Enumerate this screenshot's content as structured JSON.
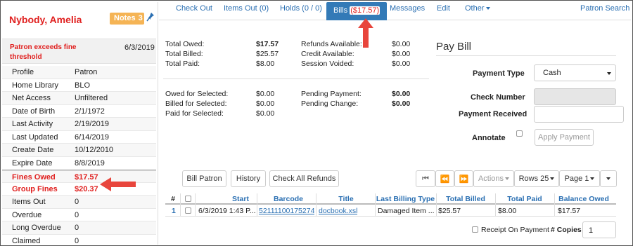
{
  "patron": {
    "name": "Nybody, Amelia",
    "notes_label": "Notes",
    "notes_count": "3"
  },
  "alert": {
    "text": "Patron exceeds fine threshold",
    "date": "6/3/2019"
  },
  "info_rows": [
    {
      "key": "Profile",
      "value": "Patron"
    },
    {
      "key": "Home Library",
      "value": "BLO"
    },
    {
      "key": "Net Access",
      "value": "Unfiltered"
    },
    {
      "key": "Date of Birth",
      "value": "2/1/1972"
    },
    {
      "key": "Last Activity",
      "value": "2/19/2019"
    },
    {
      "key": "Last Updated",
      "value": "6/14/2019"
    },
    {
      "key": "Create Date",
      "value": "10/12/2010"
    },
    {
      "key": "Expire Date",
      "value": "8/8/2019"
    },
    {
      "key": "Fines Owed",
      "value": "$17.57"
    },
    {
      "key": "Group Fines",
      "value": "$20.37"
    },
    {
      "key": "Items Out",
      "value": "0"
    },
    {
      "key": "Overdue",
      "value": "0"
    },
    {
      "key": "Long Overdue",
      "value": "0"
    },
    {
      "key": "Claimed",
      "value": "0"
    }
  ],
  "nav": {
    "check_out": "Check Out",
    "items_out": "Items Out (0)",
    "holds": "Holds (0 / 0)",
    "bills": "Bills",
    "bills_amount": "($17.57)",
    "messages": "Messages",
    "edit": "Edit",
    "other": "Other",
    "patron_search": "Patron Search"
  },
  "summary": {
    "total_owed_label": "Total Owed:",
    "total_owed": "$17.57",
    "total_billed_label": "Total Billed:",
    "total_billed": "$25.57",
    "total_paid_label": "Total Paid:",
    "total_paid": "$8.00",
    "refunds_label": "Refunds Available:",
    "refunds": "$0.00",
    "credit_label": "Credit Available:",
    "credit": "$0.00",
    "voided_label": "Session Voided:",
    "voided": "$0.00",
    "owed_sel_label": "Owed for Selected:",
    "owed_sel": "$0.00",
    "billed_sel_label": "Billed for Selected:",
    "billed_sel": "$0.00",
    "paid_sel_label": "Paid for Selected:",
    "paid_sel": "$0.00",
    "pending_payment_label": "Pending Payment:",
    "pending_payment": "$0.00",
    "pending_change_label": "Pending Change:",
    "pending_change": "$0.00"
  },
  "pay": {
    "title": "Pay Bill",
    "payment_type_label": "Payment Type",
    "payment_type_value": "Cash",
    "check_number_label": "Check Number",
    "payment_received_label": "Payment Received",
    "annotate_label": "Annotate",
    "apply_label": "Apply Payment"
  },
  "toolbar": {
    "bill_patron": "Bill Patron",
    "history": "History",
    "check_all_refunds": "Check All Refunds",
    "actions": "Actions",
    "rows": "Rows 25",
    "page": "Page 1"
  },
  "grid": {
    "headers": [
      "#",
      "Start",
      "Barcode",
      "Title",
      "Last Billing Type",
      "Total Billed",
      "Total Paid",
      "Balance Owed"
    ],
    "rows": [
      {
        "num": "1",
        "start": "6/3/2019 1:43 P...",
        "barcode": "52111100175274",
        "title": "docbook.xsl",
        "billing_type": "Damaged Item ...",
        "total_billed": "$25.57",
        "total_paid": "$8.00",
        "balance": "$17.57"
      }
    ]
  },
  "footer": {
    "receipt_label": "Receipt On Payment",
    "copies_label": "# Copies",
    "copies_value": "1"
  },
  "colors": {
    "accent": "#337ab7",
    "alert_red": "#e0201f",
    "notes_orange": "#f5b455",
    "arrow_red": "#e8453c"
  }
}
